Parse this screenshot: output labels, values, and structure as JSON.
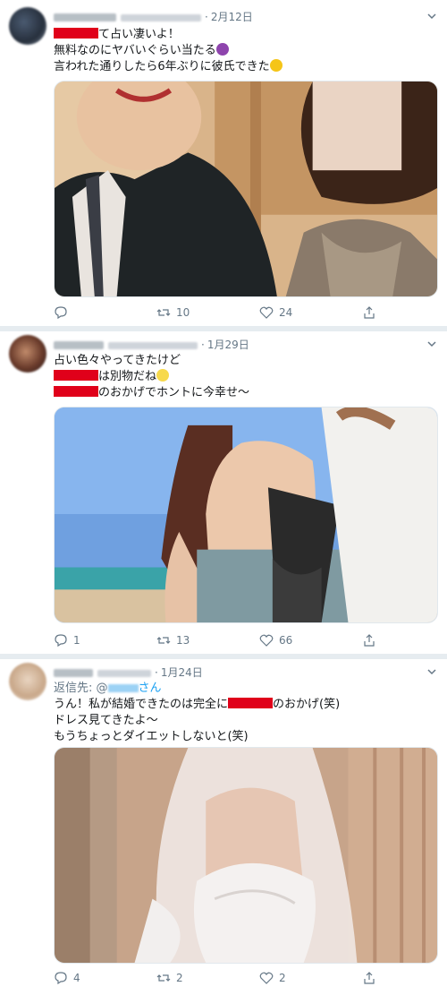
{
  "tweets": [
    {
      "date": "2月12日",
      "lines": [
        "て占い凄いよ！",
        "無料なのにヤバいぐらい当たる",
        "言われた通りしたら6年ぶりに彼氏できた"
      ],
      "replies": "",
      "retweets": "10",
      "likes": "24"
    },
    {
      "date": "1月29日",
      "lines": [
        "占い色々やってきたけど",
        "は別物だね",
        "のおかげでホントに今幸せ〜"
      ],
      "replies": "1",
      "retweets": "13",
      "likes": "66"
    },
    {
      "date": "1月24日",
      "reply_prefix": "返信先: @",
      "reply_suffix": "さん",
      "lines": [
        "うん！私が結婚できたのは完全に",
        "のおかげ(笑)",
        "ドレス見てきたよ〜",
        "もうちょっとダイエットしないと(笑)"
      ],
      "replies": "4",
      "retweets": "2",
      "likes": "2"
    }
  ],
  "colors": {
    "redaction": "#e0001a",
    "muted": "#657786",
    "link": "#1da1f2",
    "divider": "#e6ecf0"
  },
  "icons": [
    "reply-icon",
    "retweet-icon",
    "like-icon",
    "share-icon",
    "chevron-down-icon"
  ]
}
